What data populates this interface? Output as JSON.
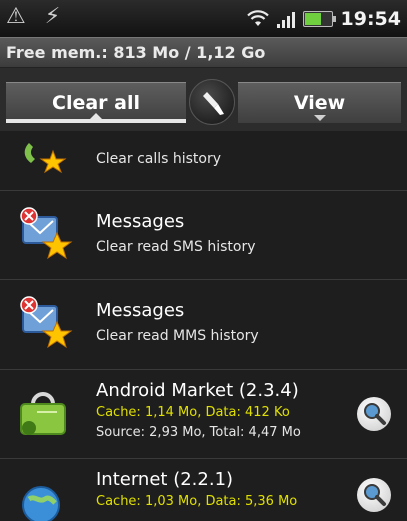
{
  "status_bar": {
    "time": "19:54",
    "left_icons": "⚠ ⚡"
  },
  "memory": {
    "label": "Free mem.: 813 Mo / 1,12 Go"
  },
  "tabs": {
    "clear_all": "Clear all",
    "view": "View"
  },
  "list": [
    {
      "title": "",
      "subtitle": "Clear calls history"
    },
    {
      "title": "Messages",
      "subtitle": "Clear read SMS history"
    },
    {
      "title": "Messages",
      "subtitle": "Clear read MMS history"
    },
    {
      "title": "Android Market (2.3.4)",
      "cache_info": "Cache: 1,14 Mo, Data: 412 Ko",
      "size_info": "Source: 2,93 Mo, Total: 4,47 Mo"
    },
    {
      "title": "Internet (2.2.1)",
      "cache_info": "Cache: 1,03 Mo, Data: 5,36 Mo",
      "size_info": ""
    }
  ],
  "colors": {
    "highlight_text": "#e0e000",
    "background": "#1e1e1e"
  }
}
